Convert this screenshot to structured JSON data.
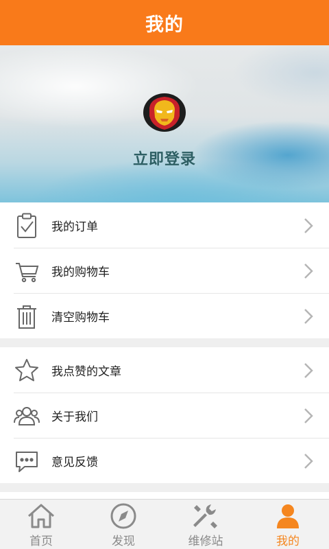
{
  "header": {
    "title": "我的"
  },
  "profile": {
    "login_label": "立即登录",
    "avatar_icon": "iron-man-avatar"
  },
  "menu_groups": [
    {
      "items": [
        {
          "label": "我的订单",
          "icon": "clipboard-check-icon"
        },
        {
          "label": "我的购物车",
          "icon": "cart-icon"
        },
        {
          "label": "清空购物车",
          "icon": "trash-icon"
        }
      ]
    },
    {
      "items": [
        {
          "label": "我点赞的文章",
          "icon": "star-icon"
        },
        {
          "label": "关于我们",
          "icon": "users-icon"
        },
        {
          "label": "意见反馈",
          "icon": "chat-bubble-icon"
        }
      ]
    }
  ],
  "tabbar": {
    "items": [
      {
        "label": "首页",
        "icon": "home-icon",
        "active": false
      },
      {
        "label": "发现",
        "icon": "compass-icon",
        "active": false
      },
      {
        "label": "维修站",
        "icon": "tools-icon",
        "active": false
      },
      {
        "label": "我的",
        "icon": "person-icon",
        "active": true
      }
    ]
  },
  "colors": {
    "accent": "#f97a1a",
    "active_tab": "#f5861f",
    "login_text": "#2e5f64"
  }
}
